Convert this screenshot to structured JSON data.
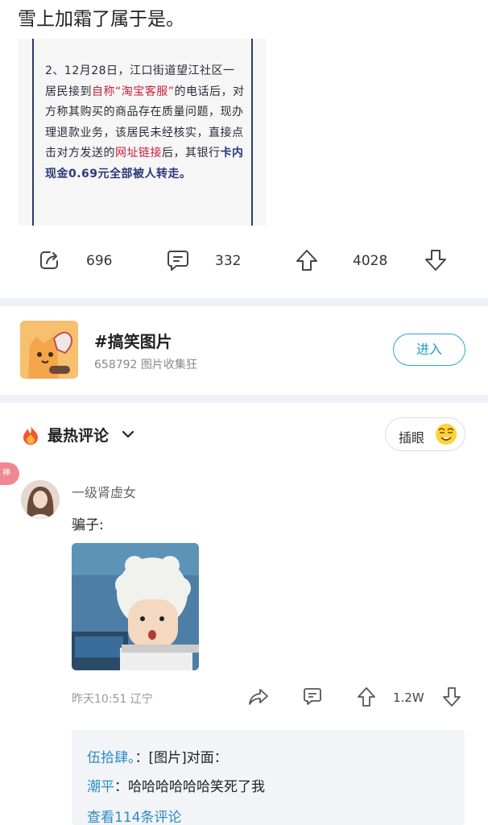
{
  "post": {
    "title": "雪上加霜了属于是。",
    "news": {
      "p1": "2、12月28日，江口街道望江社区一居民接到",
      "p2": "自称“淘宝客服”",
      "p3": "的电话后，对方称其购买的商品存在质量问题，现办理退款业务，该居民未经核实，直接点击对方发送的",
      "p4": "网址链接",
      "p5": "后，其银行",
      "p6": "卡内现金0.69元全部被人转走。"
    }
  },
  "actions": {
    "share_count": "696",
    "comment_count": "332",
    "upvote_count": "4028"
  },
  "group": {
    "name": "#搞笑图片",
    "subtitle": "658792 图片收集狂",
    "enter_label": "进入"
  },
  "hot": {
    "title": "最热评论",
    "insert_label": "插眼"
  },
  "comment": {
    "badge": "神",
    "username": "一级肾虚女",
    "text": "骗子:",
    "time": "昨天10:51 辽宁",
    "likes": "1.2W"
  },
  "replies": {
    "r1_user": "伍拾肆。",
    "r1_text": "：[图片]对面：",
    "r2_user": "潮平",
    "r2_text": "：哈哈哈哈哈哈笑死了我",
    "more": "查看114条评论"
  },
  "colors": {
    "accent": "#1f9bbf",
    "highlight_red": "#c8213c",
    "highlight_navy": "#2b3a7a",
    "link_blue": "#2b8bc2"
  }
}
